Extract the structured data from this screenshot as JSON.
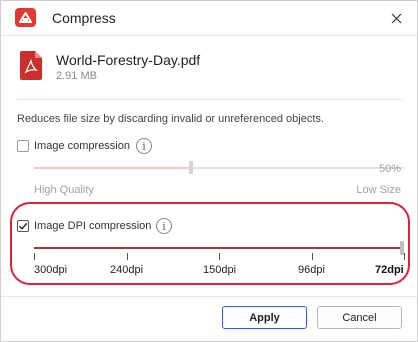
{
  "window": {
    "title": "Compress",
    "close_icon": "close-icon",
    "app_icon": "app-logo-icon"
  },
  "file": {
    "name": "World-Forestry-Day.pdf",
    "size": "2.91 MB",
    "icon": "pdf-file-icon"
  },
  "description": "Reduces file size by discarding invalid or unreferenced objects.",
  "image_compression": {
    "label": "Image compression",
    "checked": false,
    "value_percent": 50,
    "value_label": "50%",
    "low_end_label": "High Quality",
    "high_end_label": "Low Size"
  },
  "dpi_compression": {
    "label": "Image DPI compression",
    "checked": true,
    "ticks": [
      "300dpi",
      "240dpi",
      "150dpi",
      "96dpi",
      "72dpi"
    ],
    "selected": "72dpi"
  },
  "buttons": {
    "apply": "Apply",
    "cancel": "Cancel"
  },
  "colors": {
    "accent_red": "#e03a33",
    "highlight_ring": "#d9233d",
    "apply_border": "#2c62d6"
  }
}
